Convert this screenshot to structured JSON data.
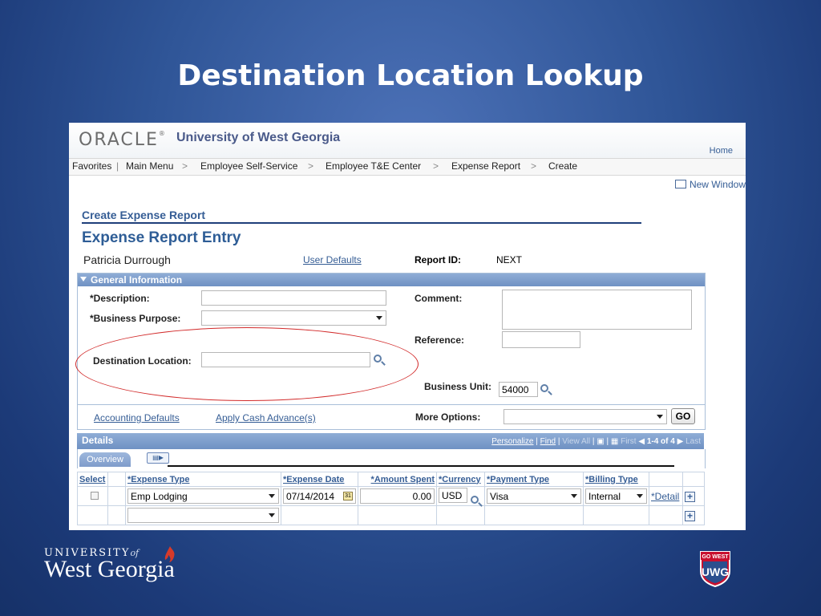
{
  "slide": {
    "title": "Destination Location Lookup"
  },
  "header": {
    "logo_text": "ORACLE",
    "org_name": "University of West Georgia",
    "home_link": "Home"
  },
  "nav": {
    "items": [
      "Favorites",
      "Main Menu",
      "Employee Self-Service",
      "Employee T&E Center",
      "Expense Report",
      "Create"
    ],
    "separator": ">"
  },
  "new_window": "New Window",
  "page": {
    "section_link": "Create Expense Report",
    "title": "Expense Report Entry",
    "employee_name": "Patricia Durrough",
    "user_defaults": "User Defaults",
    "report_id_label": "Report ID:",
    "report_id_value": "NEXT"
  },
  "general": {
    "header": "General Information",
    "description_label": "*Description:",
    "description_value": "",
    "business_purpose_label": "*Business Purpose:",
    "business_purpose_value": "",
    "destination_label": "Destination Location:",
    "destination_value": "",
    "comment_label": "Comment:",
    "comment_value": "",
    "reference_label": "Reference:",
    "reference_value": "",
    "business_unit_label": "Business Unit:",
    "business_unit_value": "54000"
  },
  "options": {
    "accounting_defaults": "Accounting Defaults",
    "apply_cash_advance": "Apply Cash Advance(s)",
    "more_options_label": "More Options:",
    "more_options_value": "",
    "go_button": "GO"
  },
  "details": {
    "header": "Details",
    "personalize": "Personalize",
    "find": "Find",
    "view_all": "View All",
    "first": "First",
    "range": "1-4 of 4",
    "last": "Last",
    "tab_overview": "Overview",
    "columns": [
      "Select",
      "*Expense Type",
      "*Expense Date",
      "*Amount Spent",
      "*Currency",
      "*Payment Type",
      "*Billing Type"
    ],
    "rows": [
      {
        "expense_type": "Emp Lodging",
        "expense_date": "07/14/2014",
        "amount": "0.00",
        "currency": "USD",
        "payment_type": "Visa",
        "billing_type": "Internal",
        "detail": "*Detail"
      },
      {
        "expense_type": "",
        "expense_date": "",
        "amount": "",
        "currency": "",
        "payment_type": "",
        "billing_type": "",
        "detail": ""
      }
    ]
  },
  "footer": {
    "uni_top": "UNIVERSITY",
    "uni_of": "of",
    "uni_bottom": "West Georgia",
    "badge_top": "GO WEST",
    "badge_main": "UWG"
  },
  "colors": {
    "accent_blue": "#355d95",
    "header_blue": "#7f9ccb",
    "highlight_red": "#d22b2b"
  }
}
